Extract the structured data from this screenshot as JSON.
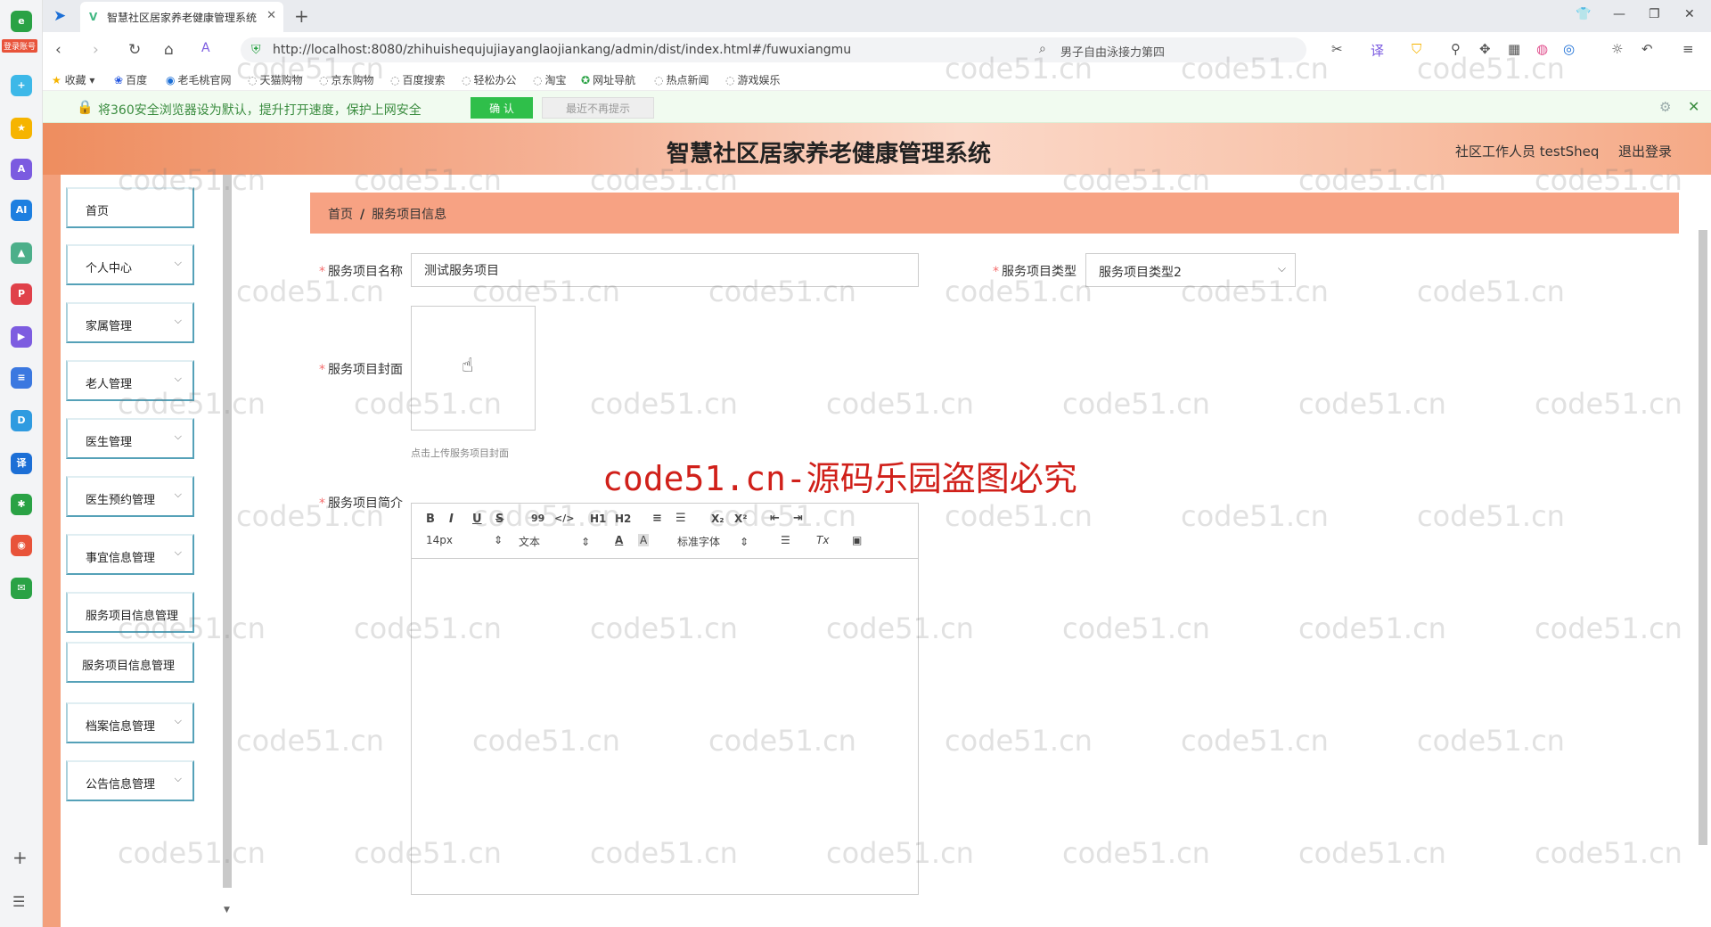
{
  "browser": {
    "tab_title": "智慧社区居家养老健康管理系统",
    "url": "http://localhost:8080/zhihuishequjujiayanglaojiankang/admin/dist/index.html#/fuwuxiangmu",
    "search_text": "男子自由泳接力第四",
    "login_badge": "登录账号"
  },
  "bookmarks": [
    "收藏",
    "百度",
    "老毛桃官网",
    "天猫购物",
    "京东购物",
    "百度搜索",
    "轻松办公",
    "淘宝",
    "网址导航",
    "热点新闻",
    "游戏娱乐"
  ],
  "notice": {
    "text": "将360安全浏览器设为默认，提升打开速度，保护上网安全",
    "confirm_label": "确 认",
    "dismiss_label": "最近不再提示"
  },
  "app": {
    "title": "智慧社区居家养老健康管理系统",
    "user": "社区工作人员 testSheq",
    "logout": "退出登录"
  },
  "sidebar": {
    "items": [
      {
        "label": "首页",
        "has_children": false
      },
      {
        "label": "个人中心",
        "has_children": true
      },
      {
        "label": "家属管理",
        "has_children": true
      },
      {
        "label": "老人管理",
        "has_children": true
      },
      {
        "label": "医生管理",
        "has_children": true
      },
      {
        "label": "医生预约管理",
        "has_children": true
      },
      {
        "label": "事宜信息管理",
        "has_children": true
      },
      {
        "label": "服务项目信息管理",
        "has_children": false
      },
      {
        "label": "服务项目信息管理",
        "has_children": false
      },
      {
        "label": "档案信息管理",
        "has_children": true
      },
      {
        "label": "公告信息管理",
        "has_children": true
      }
    ]
  },
  "breadcrumb": {
    "home": "首页",
    "separator": "/",
    "current": "服务项目信息"
  },
  "form": {
    "name_label": "服务项目名称",
    "name_value": "测试服务项目",
    "type_label": "服务项目类型",
    "type_value": "服务项目类型2",
    "cover_label": "服务项目封面",
    "cover_hint": "点击上传服务项目封面",
    "intro_label": "服务项目简介"
  },
  "editor": {
    "buttons": [
      "B",
      "I",
      "U",
      "S",
      "99",
      "</>",
      "H1",
      "H2",
      "≡",
      "☰",
      "X₂",
      "X²",
      "⇤",
      "⇥"
    ],
    "font_size": "14px",
    "text_style": "文本",
    "font_family": "标准字体"
  },
  "watermark": {
    "repeated": "code51.cn",
    "center": "code51.cn-源码乐园盗图必究"
  }
}
